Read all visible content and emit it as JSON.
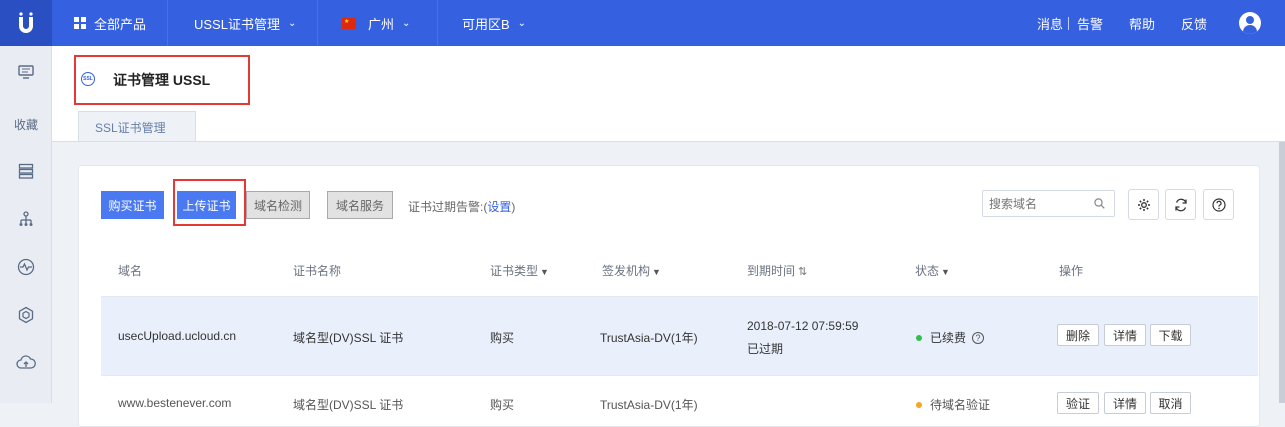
{
  "topnav": {
    "all_products": "全部产品",
    "product": "USSL证书管理",
    "region": "广州",
    "zone": "可用区B",
    "messages": "消息",
    "alerts": "告警",
    "help": "帮助",
    "feedback": "反馈"
  },
  "sidebar": {
    "favorites": "收藏"
  },
  "page": {
    "title": "证书管理 USSL",
    "ssl_badge": "SSL",
    "tab": "SSL证书管理"
  },
  "toolbar": {
    "buy": "购买证书",
    "upload": "上传证书",
    "domain_check": "域名检测",
    "domain_service": "域名服务",
    "expiry_alert_prefix": "证书过期告警:(",
    "expiry_alert_link": "设置",
    "expiry_alert_suffix": ")",
    "search_placeholder": "搜索域名"
  },
  "table": {
    "headers": {
      "domain": "域名",
      "cert_name": "证书名称",
      "cert_type": "证书类型",
      "issuer": "签发机构",
      "expire": "到期时间",
      "status": "状态",
      "ops": "操作"
    },
    "rows": [
      {
        "domain": "usecUpload.ucloud.cn",
        "cert_name": "域名型(DV)SSL 证书",
        "cert_type": "购买",
        "issuer": "TrustAsia-DV(1年)",
        "expire_date": "2018-07-12 07:59:59",
        "expire_note": "已过期",
        "status": "已续费",
        "ops": [
          "删除",
          "详情",
          "下载"
        ]
      },
      {
        "domain": "www.bestenever.com",
        "cert_name": "域名型(DV)SSL 证书",
        "cert_type": "购买",
        "issuer": "TrustAsia-DV(1年)",
        "status": "待域名验证",
        "ops": [
          "验证",
          "详情",
          "取消"
        ]
      }
    ]
  },
  "colors": {
    "nav": "#3560e0",
    "primary": "#4a79f1",
    "highlight": "#e53935",
    "ok": "#2fbf4f",
    "pending": "#f5a623"
  }
}
